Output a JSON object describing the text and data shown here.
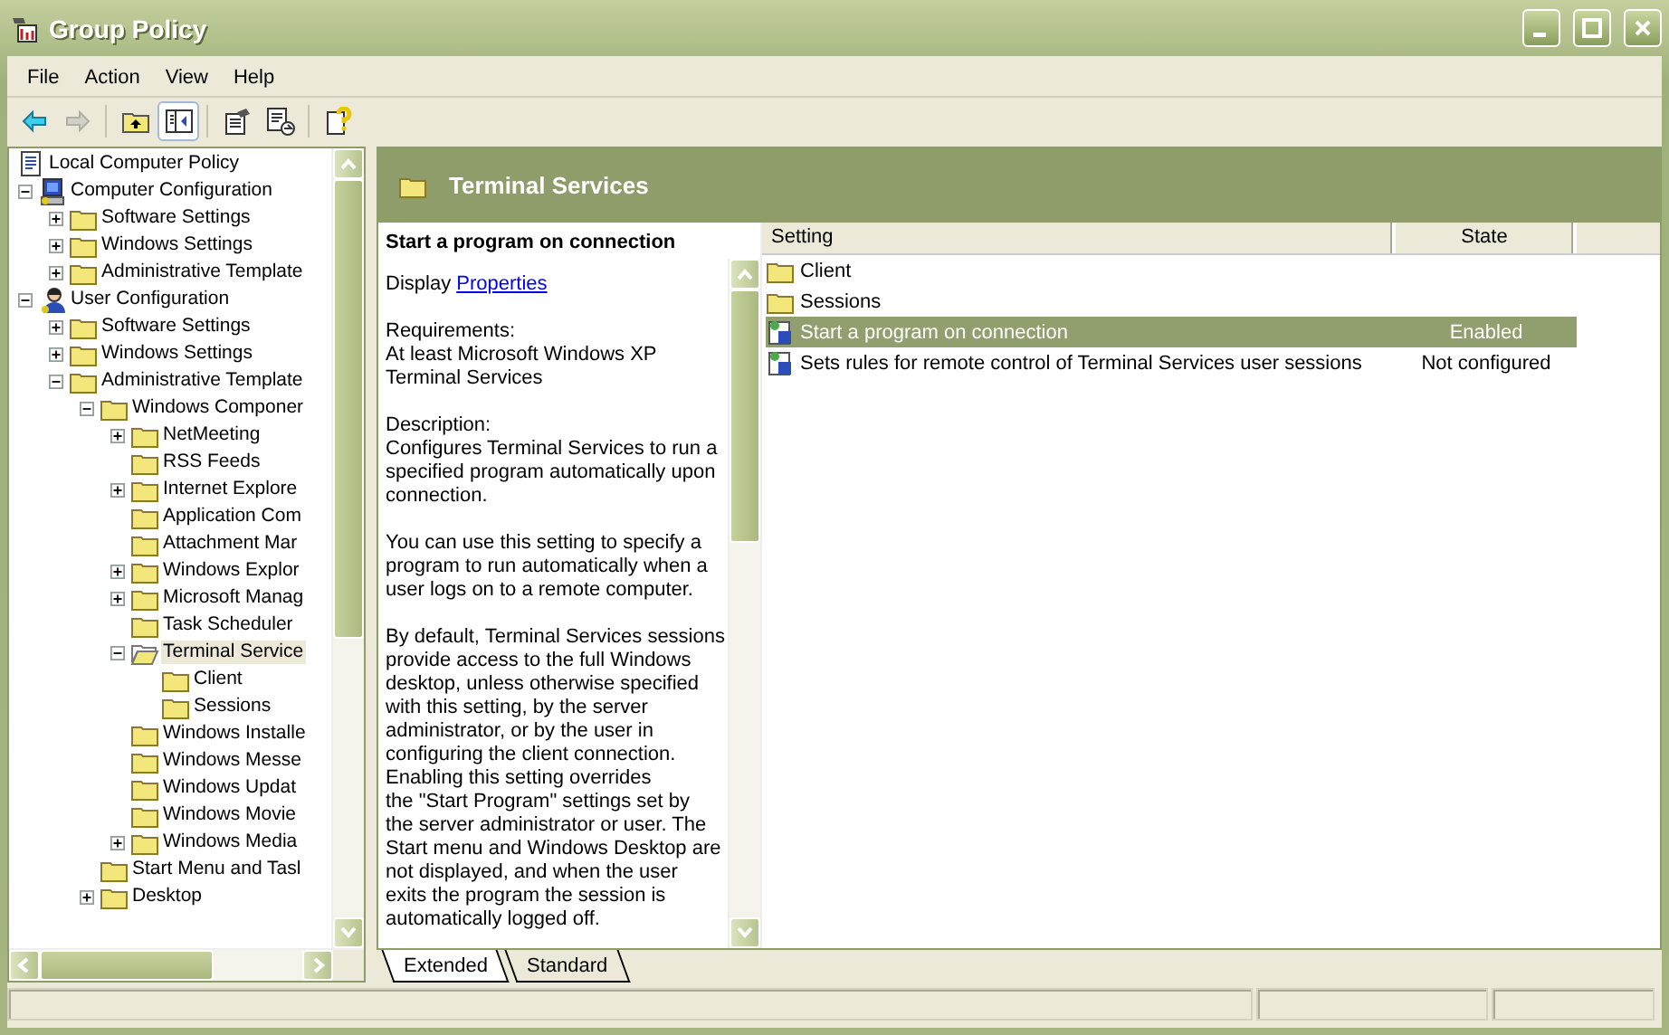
{
  "window": {
    "title": "Group Policy"
  },
  "menu": [
    "File",
    "Action",
    "View",
    "Help"
  ],
  "toolbar": [
    {
      "kind": "back",
      "disabled": false
    },
    {
      "kind": "forward",
      "disabled": true
    },
    {
      "kind": "up",
      "disabled": false,
      "pressed": false
    },
    {
      "kind": "tree",
      "disabled": false,
      "pressed": true
    },
    {
      "kind": "properties",
      "disabled": false
    },
    {
      "kind": "export",
      "disabled": false
    },
    {
      "kind": "help",
      "disabled": false
    }
  ],
  "tree": [
    {
      "label": "Local Computer Policy",
      "kind": "policy",
      "selected": false,
      "children": [
        {
          "label": "Computer Configuration",
          "kind": "computer",
          "expanded": true,
          "selected": false,
          "children": [
            {
              "label": "Software Settings",
              "kind": "folder",
              "expanded": false,
              "selected": false
            },
            {
              "label": "Windows Settings",
              "kind": "folder",
              "expanded": false,
              "selected": false
            },
            {
              "label": "Administrative Template",
              "kind": "folder",
              "expanded": false,
              "selected": false
            }
          ]
        },
        {
          "label": "User Configuration",
          "kind": "user",
          "expanded": true,
          "selected": false,
          "children": [
            {
              "label": "Software Settings",
              "kind": "folder",
              "expanded": false,
              "selected": false
            },
            {
              "label": "Windows Settings",
              "kind": "folder",
              "expanded": false,
              "selected": false
            },
            {
              "label": "Administrative Template",
              "kind": "folder",
              "expanded": true,
              "selected": false,
              "children": [
                {
                  "label": "Windows Componer",
                  "kind": "folder",
                  "expanded": true,
                  "selected": false,
                  "children": [
                    {
                      "label": "NetMeeting",
                      "kind": "folder",
                      "expanded": false,
                      "selected": false
                    },
                    {
                      "label": "RSS Feeds",
                      "kind": "folder",
                      "selected": false
                    },
                    {
                      "label": "Internet Explore",
                      "kind": "folder",
                      "expanded": false,
                      "selected": false
                    },
                    {
                      "label": "Application Com",
                      "kind": "folder",
                      "selected": false
                    },
                    {
                      "label": "Attachment Mar",
                      "kind": "folder",
                      "selected": false
                    },
                    {
                      "label": "Windows Explor",
                      "kind": "folder",
                      "expanded": false,
                      "selected": false
                    },
                    {
                      "label": "Microsoft Manag",
                      "kind": "folder",
                      "expanded": false,
                      "selected": false
                    },
                    {
                      "label": "Task Scheduler",
                      "kind": "folder",
                      "selected": false
                    },
                    {
                      "label": "Terminal Service",
                      "kind": "folder-open",
                      "expanded": true,
                      "selected": true,
                      "children": [
                        {
                          "label": "Client",
                          "kind": "folder",
                          "selected": false
                        },
                        {
                          "label": "Sessions",
                          "kind": "folder",
                          "selected": false
                        }
                      ]
                    },
                    {
                      "label": "Windows Installe",
                      "kind": "folder",
                      "selected": false
                    },
                    {
                      "label": "Windows Messe",
                      "kind": "folder",
                      "selected": false
                    },
                    {
                      "label": "Windows Updat",
                      "kind": "folder",
                      "selected": false
                    },
                    {
                      "label": "Windows Movie",
                      "kind": "folder",
                      "selected": false
                    },
                    {
                      "label": "Windows Media",
                      "kind": "folder",
                      "expanded": false,
                      "selected": false
                    }
                  ]
                },
                {
                  "label": "Start Menu and Tasl",
                  "kind": "folder",
                  "selected": false
                },
                {
                  "label": "Desktop",
                  "kind": "folder",
                  "expanded": false,
                  "selected": false
                }
              ]
            }
          ]
        }
      ]
    }
  ],
  "header": {
    "title": "Terminal Services"
  },
  "description": {
    "title": "Start a program on connection",
    "display": "Display",
    "link": "Properties",
    "paragraphs": [
      [
        "Requirements:",
        "At least Microsoft Windows XP",
        "Terminal Services"
      ],
      [
        "Description:",
        "Configures Terminal Services to run a",
        "specified program automatically upon",
        "connection."
      ],
      [
        "You can use this setting to specify a",
        "program to run automatically when a",
        "user logs on to a remote computer."
      ],
      [
        "By default, Terminal Services sessions",
        "provide access to the full Windows",
        "desktop, unless otherwise specified",
        "with this setting, by the server",
        "administrator, or by the user in",
        "configuring the client connection.",
        "Enabling this setting overrides",
        "the \"Start Program\" settings set by",
        "the server administrator or user. The",
        "Start menu and Windows Desktop are",
        "not displayed, and when the user",
        "exits the program the session is",
        "automatically logged off."
      ]
    ]
  },
  "list": {
    "columns": [
      "Setting",
      "State"
    ],
    "rows": [
      {
        "kind": "folder",
        "setting": "Client",
        "selected": false
      },
      {
        "kind": "folder",
        "setting": "Sessions",
        "selected": false
      },
      {
        "kind": "policy",
        "setting": "Start a program on connection",
        "state": "Enabled",
        "selected": true
      },
      {
        "kind": "policy",
        "setting": "Sets rules for remote control of Terminal Services user sessions",
        "state": "Not configured",
        "selected": false
      }
    ]
  },
  "tabs": [
    {
      "label": "Extended",
      "selected": true
    },
    {
      "label": "Standard",
      "selected": false
    }
  ]
}
